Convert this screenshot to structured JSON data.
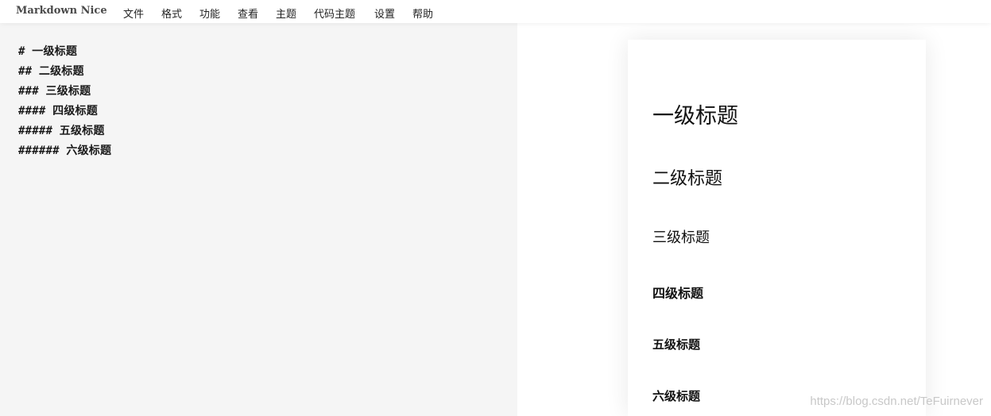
{
  "app": {
    "brand": "Markdown Nice"
  },
  "menu": {
    "items": [
      {
        "label": "文件"
      },
      {
        "label": "格式"
      },
      {
        "label": "功能"
      },
      {
        "label": "查看"
      },
      {
        "label": "主题"
      },
      {
        "label": "代码主题"
      },
      {
        "label": "设置"
      },
      {
        "label": "帮助"
      }
    ]
  },
  "editor": {
    "lines": [
      "# 一级标题",
      "## 二级标题",
      "### 三级标题",
      "#### 四级标题",
      "##### 五级标题",
      "###### 六级标题"
    ]
  },
  "preview": {
    "h1": "一级标题",
    "h2": "二级标题",
    "h3": "三级标题",
    "h4": "四级标题",
    "h5": "五级标题",
    "h6": "六级标题"
  },
  "watermark": "https://blog.csdn.net/TeFuirnever"
}
